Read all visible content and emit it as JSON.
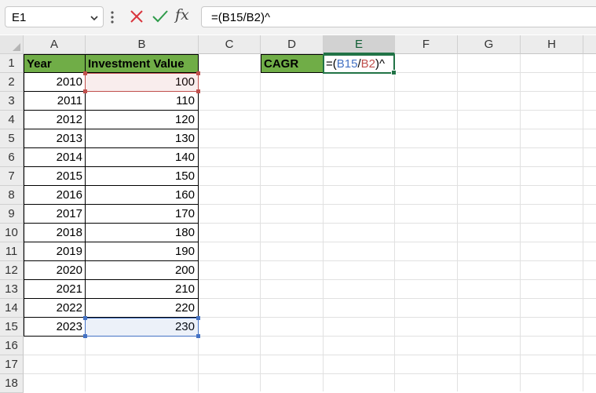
{
  "formula_bar": {
    "name_box": "E1",
    "formula": "=(B15/B2)^",
    "fx_label": "fx"
  },
  "columns": [
    "A",
    "B",
    "C",
    "D",
    "E",
    "F",
    "G",
    "H"
  ],
  "rows": [
    "1",
    "2",
    "3",
    "4",
    "5",
    "6",
    "7",
    "8",
    "9",
    "10",
    "11",
    "12",
    "13",
    "14",
    "15",
    "16",
    "17",
    "18"
  ],
  "table": {
    "header_year": "Year",
    "header_value": "Investment Value",
    "years": [
      "2010",
      "2011",
      "2012",
      "2013",
      "2014",
      "2015",
      "2016",
      "2017",
      "2018",
      "2019",
      "2020",
      "2021",
      "2022",
      "2023"
    ],
    "values": [
      "100",
      "110",
      "120",
      "130",
      "140",
      "150",
      "160",
      "170",
      "180",
      "190",
      "200",
      "210",
      "220",
      "230"
    ]
  },
  "cagr": {
    "label": "CAGR",
    "formula_parts": [
      "=(",
      "B15",
      "/",
      "B2",
      ")^"
    ]
  },
  "colors": {
    "header_fill": "#70ad47",
    "ref_blue": "#4472c4",
    "ref_red": "#c0504d",
    "active_border": "#217346"
  }
}
